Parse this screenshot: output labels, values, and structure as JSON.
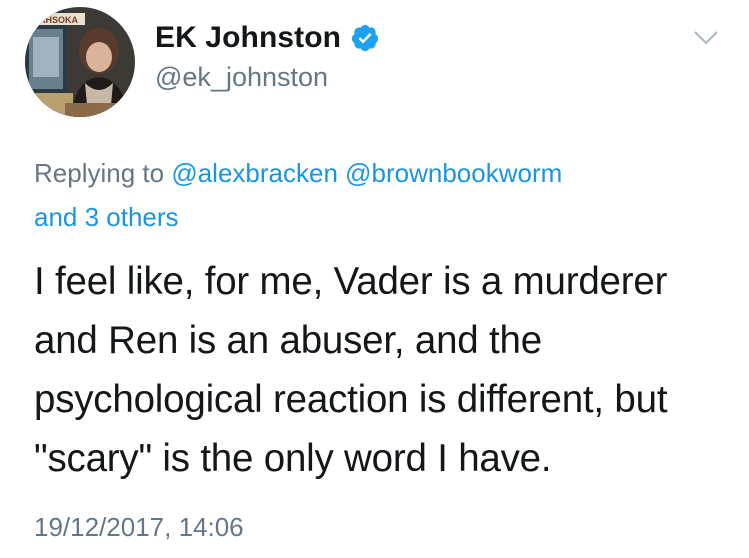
{
  "author": {
    "display_name": "EK Johnston",
    "handle": "@ek_johnston",
    "verified": true,
    "avatar_label": "AHSOKA"
  },
  "reply": {
    "prefix": "Replying to",
    "mentions": [
      "@alexbracken",
      "@brownbookworm"
    ],
    "others": "and 3 others"
  },
  "tweet": {
    "lines": [
      "I feel like, for me, Vader is a murderer",
      "and Ren is an abuser, and the",
      "psychological reaction is different, but",
      "\"scary\" is the only word I have."
    ]
  },
  "timestamp": "19/12/2017, 14:06",
  "colors": {
    "link": "#1b95e0",
    "secondary_text": "#657786",
    "primary_text": "#14171a",
    "verified_badge": "#1da1f2"
  },
  "icons": {
    "verified": "verified-badge-icon",
    "menu": "chevron-down-icon"
  }
}
